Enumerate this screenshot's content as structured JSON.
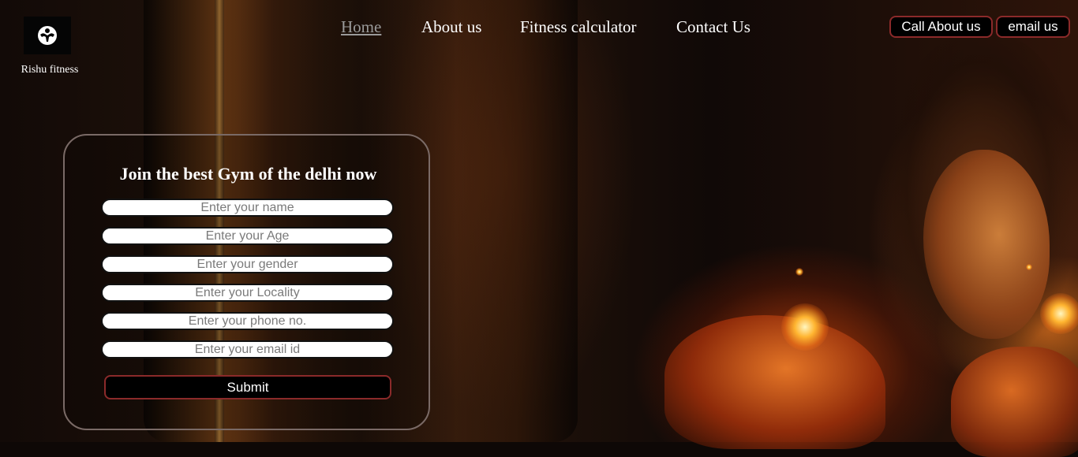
{
  "brand": {
    "logo_icon": "bodybuilder-icon",
    "name": "Rishu fitness"
  },
  "nav": {
    "items": [
      {
        "label": "Home",
        "active": true
      },
      {
        "label": "About us",
        "active": false
      },
      {
        "label": "Fitness calculator",
        "active": false
      },
      {
        "label": "Contact Us",
        "active": false
      }
    ]
  },
  "header_buttons": {
    "call_label": "Call About us",
    "email_label": "email us"
  },
  "form": {
    "title": "Join the best Gym of the delhi now",
    "fields": [
      {
        "placeholder": "Enter your name",
        "value": ""
      },
      {
        "placeholder": "Enter your Age",
        "value": ""
      },
      {
        "placeholder": "Enter your gender",
        "value": ""
      },
      {
        "placeholder": "Enter your Locality",
        "value": ""
      },
      {
        "placeholder": "Enter your phone no.",
        "value": ""
      },
      {
        "placeholder": "Enter your email id",
        "value": ""
      }
    ],
    "submit_label": "Submit"
  },
  "colors": {
    "button_border": "#8b2a2a",
    "nav_active": "#9a9a9a",
    "form_border": "#7a6a66"
  }
}
